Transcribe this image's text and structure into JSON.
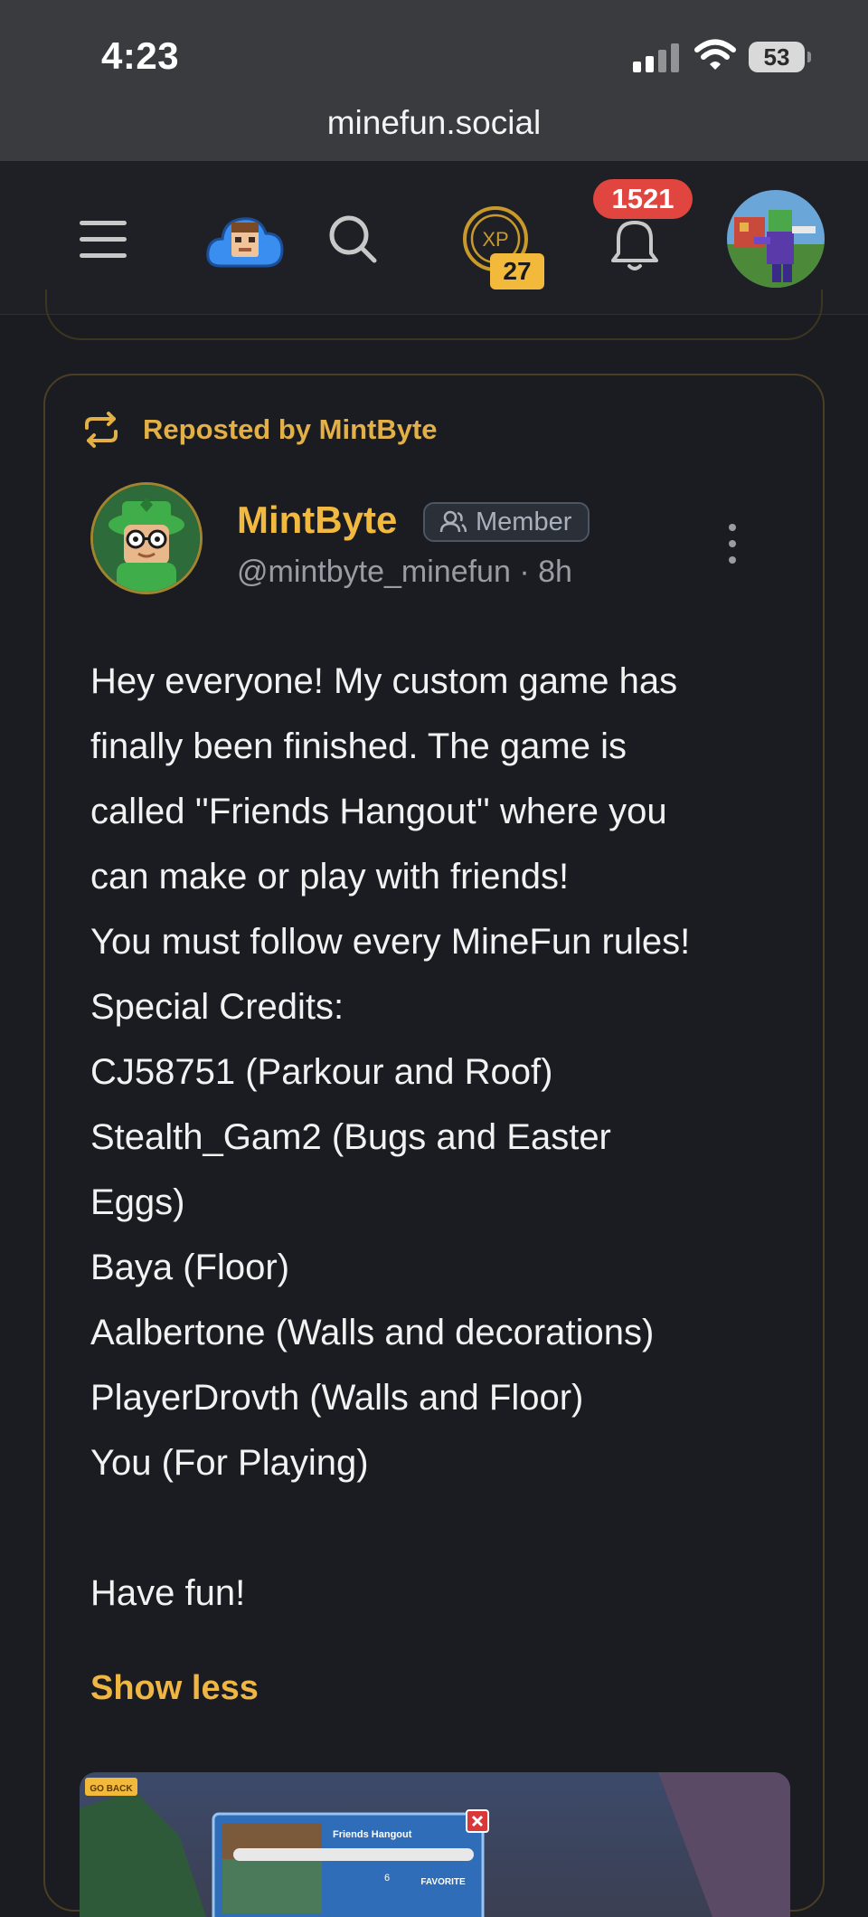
{
  "status_bar": {
    "time": "4:23",
    "battery_level": "53"
  },
  "browser": {
    "url": "minefun.social"
  },
  "navbar": {
    "xp_icon_label": "XP",
    "xp_level": "27",
    "notification_count": "1521"
  },
  "post": {
    "repost_label": "Reposted by MintByte",
    "author_name": "MintByte",
    "author_role": "Member",
    "author_handle": "@mintbyte_minefun · 8h",
    "body_lines": [
      "Hey everyone! My custom game has",
      "finally been finished. The game is",
      "called ''Friends Hangout'' where you",
      "can make or play with friends!",
      "You must follow every MineFun rules!",
      "Special Credits:",
      "CJ58751 (Parkour and Roof)",
      "Stealth_Gam2 (Bugs and Easter",
      "Eggs)",
      "Baya (Floor)",
      "Aalbertone (Walls and decorations)",
      "PlayerDrovth (Walls and Floor)",
      "You (For Playing)",
      "",
      "Have fun!"
    ],
    "show_less_label": "Show less",
    "media": {
      "back_label": "GO BACK",
      "game_title": "Friends Hangout",
      "likes": "6",
      "favorite_label": "FAVORITE"
    }
  },
  "colors": {
    "accent_gold": "#f1b940",
    "notification_red": "#e0463f",
    "background": "#1b1c21"
  }
}
